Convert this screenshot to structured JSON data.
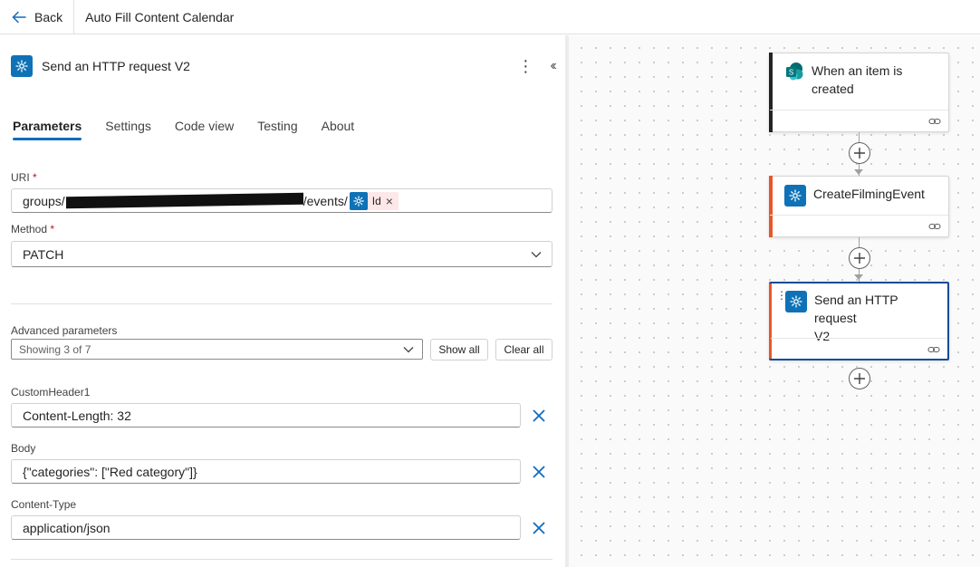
{
  "topbar": {
    "back_label": "Back",
    "flow_title": "Auto Fill Content Calendar"
  },
  "panel": {
    "title": "Send an HTTP request V2",
    "tabs": [
      {
        "label": "Parameters",
        "active": true
      },
      {
        "label": "Settings",
        "active": false
      },
      {
        "label": "Code view",
        "active": false
      },
      {
        "label": "Testing",
        "active": false
      },
      {
        "label": "About",
        "active": false
      }
    ],
    "uri": {
      "label": "URI",
      "required_mark": "*",
      "prefix": "groups/",
      "suffix": "/events/",
      "token_label": "Id"
    },
    "method": {
      "label": "Method",
      "required_mark": "*",
      "value": "PATCH"
    },
    "advanced": {
      "label": "Advanced parameters",
      "summary": "Showing 3 of 7",
      "show_all": "Show all",
      "clear_all": "Clear all"
    },
    "params": [
      {
        "label": "CustomHeader1",
        "value": "Content-Length: 32"
      },
      {
        "label": "Body",
        "value": "{\"categories\": [\"Red category\"]}"
      },
      {
        "label": "Content-Type",
        "value": "application/json"
      }
    ]
  },
  "canvas": {
    "nodes": [
      {
        "label_line1": "When an item is",
        "label_line2": "created",
        "bar_color": "#242424",
        "icon": "sharepoint-icon"
      },
      {
        "label_line1": "CreateFilmingEvent",
        "label_line2": "",
        "bar_color": "#e8562a",
        "icon": "http-icon"
      },
      {
        "label_line1": "Send an HTTP request",
        "label_line2": "V2",
        "bar_color": "#e8562a",
        "icon": "http-icon"
      }
    ]
  },
  "colors": {
    "accent": "#0f6cbd",
    "action_icon": "#0f72b7",
    "selected_border": "#0f4c97",
    "error_bar": "#e8562a"
  }
}
